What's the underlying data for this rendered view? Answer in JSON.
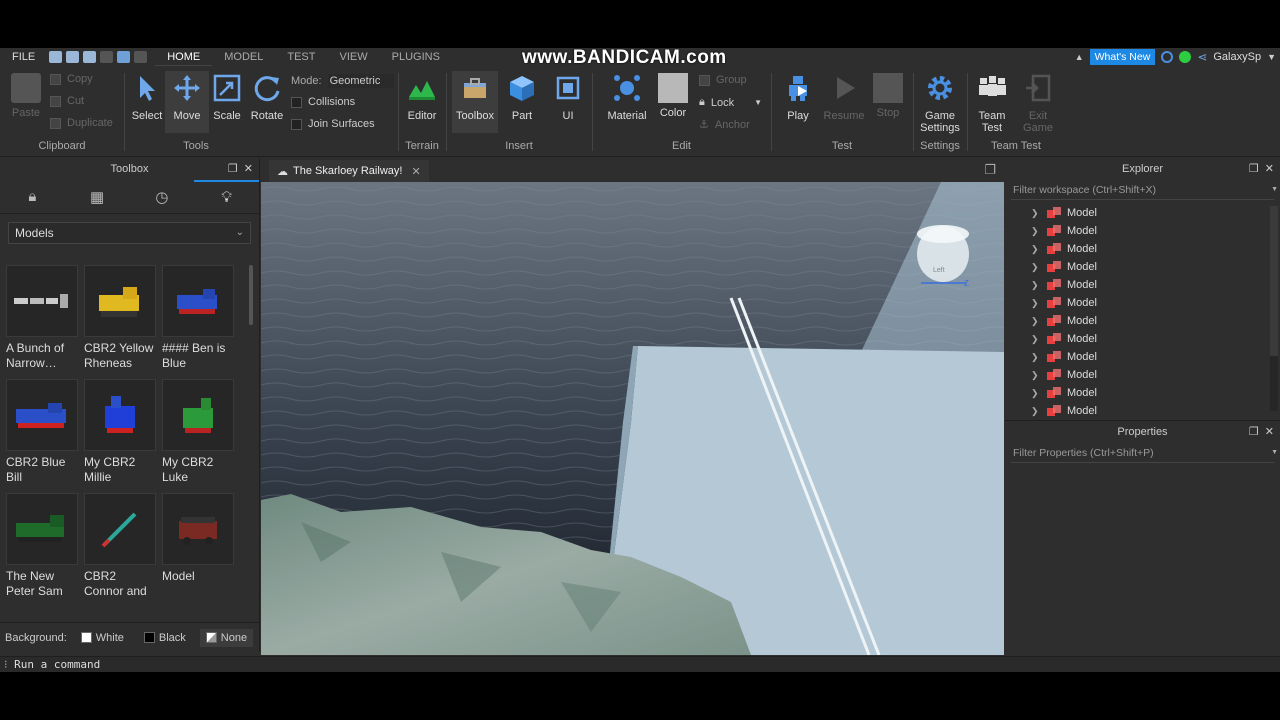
{
  "watermark": "www.BANDICAM.com",
  "menubar": {
    "file": "FILE",
    "tabs": [
      "HOME",
      "MODEL",
      "TEST",
      "VIEW",
      "PLUGINS"
    ],
    "whats_new": "What's New",
    "user": "GalaxySp"
  },
  "ribbon": {
    "clipboard": {
      "paste": "Paste",
      "copy": "Copy",
      "cut": "Cut",
      "duplicate": "Duplicate",
      "label": "Clipboard"
    },
    "tools": {
      "select": "Select",
      "move": "Move",
      "scale": "Scale",
      "rotate": "Rotate",
      "mode_label": "Mode:",
      "mode_value": "Geometric",
      "collisions": "Collisions",
      "join_surfaces": "Join Surfaces",
      "label": "Tools"
    },
    "terrain": {
      "editor": "Editor",
      "label": "Terrain"
    },
    "insert": {
      "toolbox": "Toolbox",
      "part": "Part",
      "ui": "UI",
      "label": "Insert"
    },
    "edit": {
      "material": "Material",
      "color": "Color",
      "group": "Group",
      "lock": "Lock",
      "anchor": "Anchor",
      "label": "Edit"
    },
    "test": {
      "play": "Play",
      "resume": "Resume",
      "stop": "Stop",
      "label": "Test"
    },
    "settings": {
      "game_settings_1": "Game",
      "game_settings_2": "Settings",
      "label": "Settings"
    },
    "team_test": {
      "team_1": "Team",
      "team_2": "Test",
      "exit_1": "Exit",
      "exit_2": "Game",
      "label": "Team Test"
    }
  },
  "toolbox": {
    "title": "Toolbox",
    "category": "Models",
    "items": [
      {
        "name": "A Bunch of Narrow…"
      },
      {
        "name": "CBR2 Yellow Rheneas"
      },
      {
        "name": "#### Ben is Blue"
      },
      {
        "name": "CBR2 Blue Bill"
      },
      {
        "name": "My CBR2 Millie"
      },
      {
        "name": "My CBR2 Luke"
      },
      {
        "name": "The New Peter Sam"
      },
      {
        "name": "CBR2 Connor and"
      },
      {
        "name": "Model"
      }
    ],
    "background_label": "Background:",
    "bg_white": "White",
    "bg_black": "Black",
    "bg_none": "None"
  },
  "viewport": {
    "tab_title": "The Skarloey Railway!",
    "cube_label": "Left",
    "cube_axis": "Z"
  },
  "explorer": {
    "title": "Explorer",
    "filter_placeholder": "Filter workspace (Ctrl+Shift+X)",
    "items": [
      "Model",
      "Model",
      "Model",
      "Model",
      "Model",
      "Model",
      "Model",
      "Model",
      "Model",
      "Model",
      "Model",
      "Model"
    ]
  },
  "properties": {
    "title": "Properties",
    "filter_placeholder": "Filter Properties (Ctrl+Shift+P)"
  },
  "command_bar": {
    "placeholder": "Run a command"
  },
  "colors": {
    "accent": "#1e88e5",
    "panel": "#2e2e2e",
    "water": "#3a4552",
    "platform": "#a9c3d3"
  }
}
